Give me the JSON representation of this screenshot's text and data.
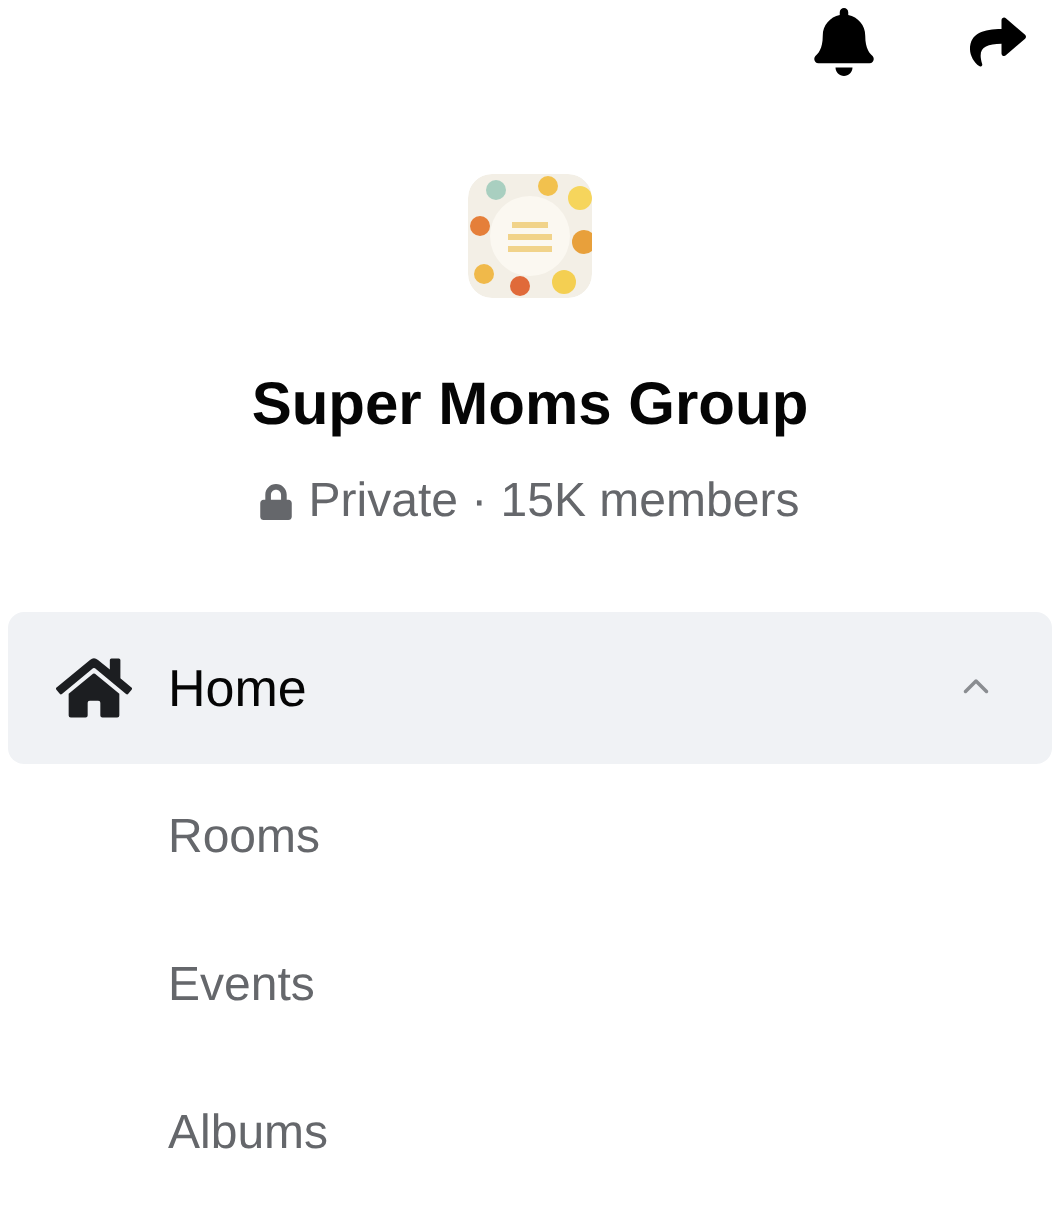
{
  "group": {
    "name": "Super Moms Group",
    "privacy": "Private · 15K members"
  },
  "nav": [
    {
      "label": "Home",
      "selected": true,
      "expanded": true
    },
    {
      "label": "Rooms",
      "selected": false
    },
    {
      "label": "Events",
      "selected": false
    },
    {
      "label": "Albums",
      "selected": false
    }
  ]
}
